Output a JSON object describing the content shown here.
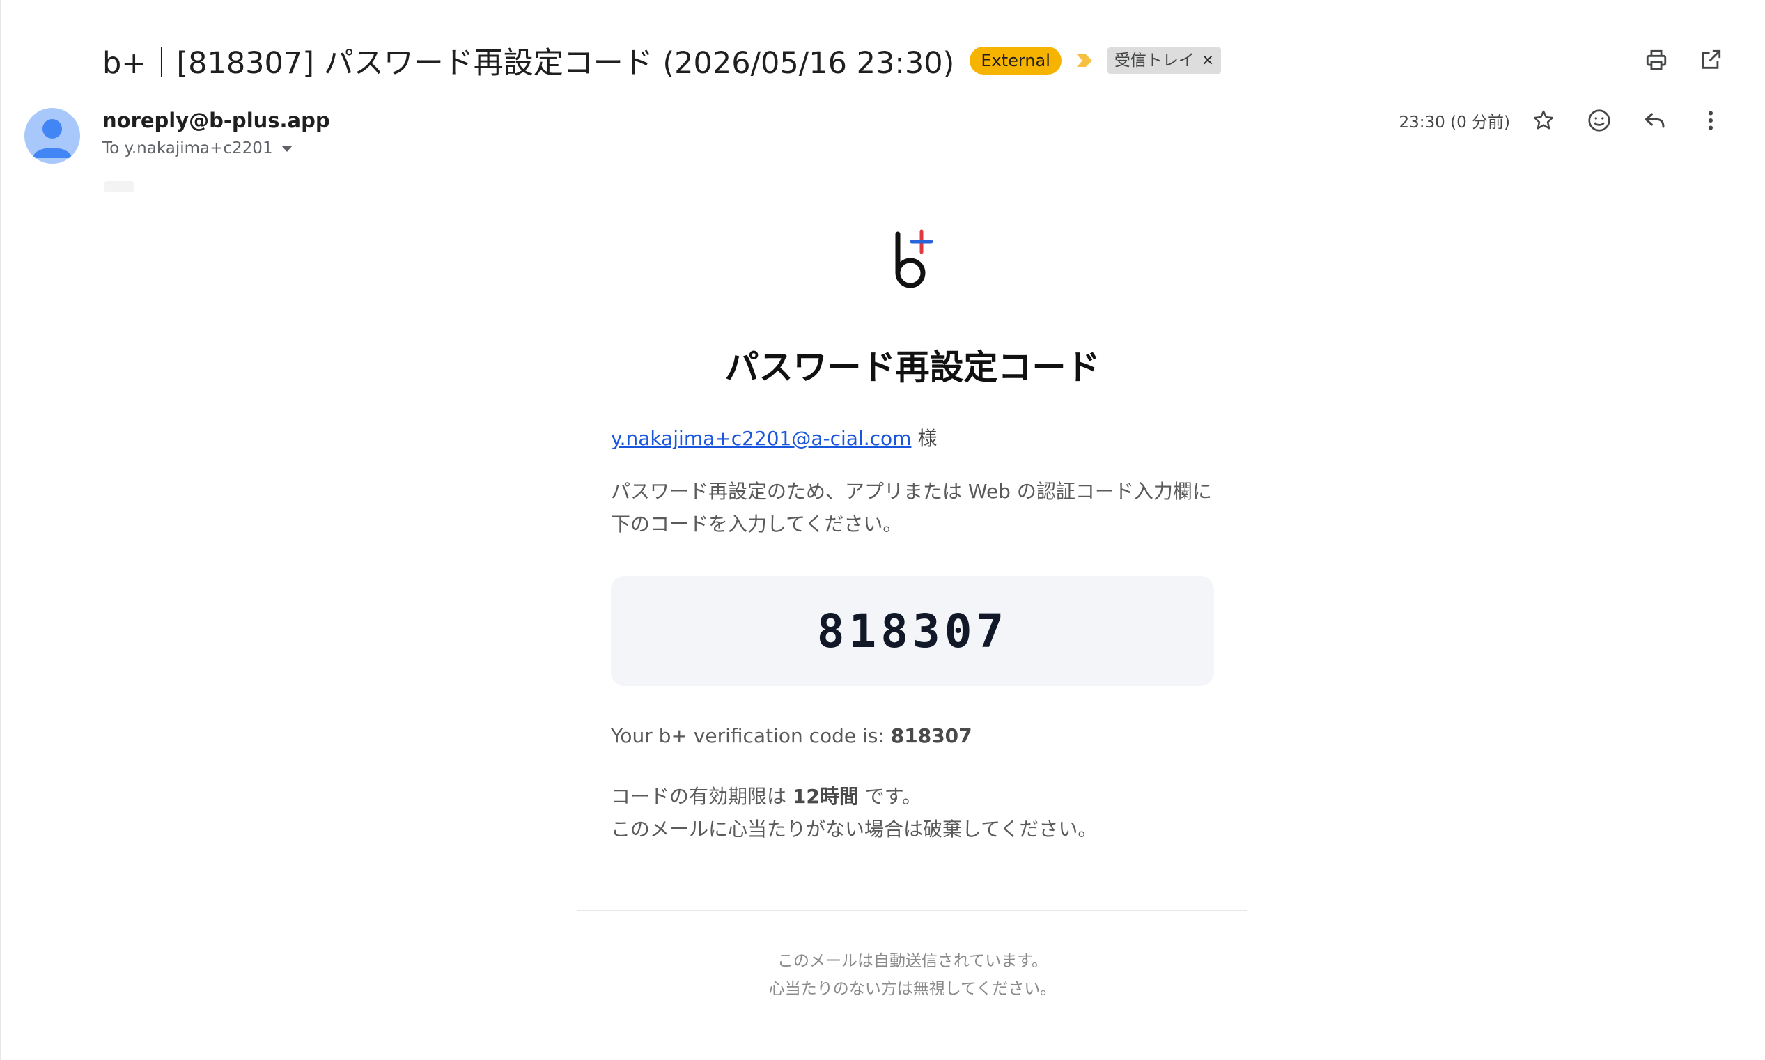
{
  "header": {
    "subject": "b+｜[818307] パスワード再設定コード (2026/05/16 23:30)",
    "external_badge": "External",
    "label_chip": "受信トレイ",
    "label_chip_close": "×",
    "actions": [
      "print-icon",
      "open-in-new-window-icon"
    ]
  },
  "sender": {
    "email": "noreply@b-plus.app",
    "recipient_line": "To y.nakajima+c2201",
    "timestamp": "23:30 (0 分前)",
    "actions": [
      "star-icon",
      "emoji-reaction-icon",
      "reply-icon",
      "more-vert-icon"
    ]
  },
  "email": {
    "logo_text": "b",
    "title": "パスワード再設定コード",
    "greeting_email": "y.nakajima+c2201@a-cial.com",
    "greeting_suffix": " 様",
    "instructions": "パスワード再設定のため、アプリまたは Web の認証コード入力欄に下のコードを入力してください。",
    "code": "818307",
    "verify_prefix": "Your b+ verification code is: ",
    "verify_code": "818307",
    "expiry_prefix": "コードの有効期限は ",
    "expiry_value": "12時間",
    "expiry_suffix": " です。",
    "discard_note": "このメールに心当たりがない場合は破棄してください。",
    "footer_line1": "このメールは自動送信されています。",
    "footer_line2": "心当たりのない方は無視してください。"
  },
  "colors": {
    "external_badge": "#f6b400",
    "important_marker": "#f6c042",
    "link": "#1a56db",
    "avatar": "#a8c7fa",
    "avatar_figure": "#4285f4",
    "logo_plus_red": "#e03a3e",
    "logo_plus_blue": "#2b63d9",
    "code_box": "#f3f5f9"
  }
}
